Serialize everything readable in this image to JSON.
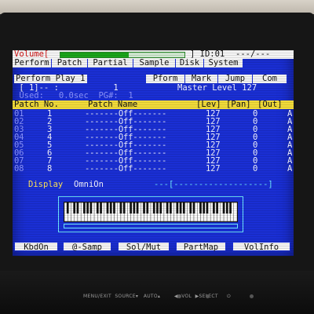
{
  "topbar": {
    "volume_label": "Volume[",
    "volume_level": 0.55,
    "id_label": "] ID:01",
    "id_value": "---/---"
  },
  "mode_tabs": [
    {
      "label": "Perform",
      "active": true
    },
    {
      "label": "Patch",
      "active": false
    },
    {
      "label": "Partial",
      "active": false
    },
    {
      "label": "Sample",
      "active": false
    },
    {
      "label": "Disk",
      "active": false
    },
    {
      "label": "System",
      "active": false
    }
  ],
  "sub": {
    "title": "Perform Play 1",
    "tabs": [
      {
        "label": "Pform",
        "active": true
      },
      {
        "label": "Mark",
        "active": false
      },
      {
        "label": "Jump",
        "active": false
      },
      {
        "label": "Com",
        "active": false
      }
    ]
  },
  "info": {
    "line1": " [ 1]-- :           1",
    "master": "Master Level 127",
    "line2": " Used:   0.0sec  PG#:  1"
  },
  "table": {
    "headers": {
      "patch_no": "Patch No.",
      "patch_name": "Patch Name",
      "level": "[Lev]",
      "pan": "[Pan]",
      "out": "[Out]"
    },
    "rows": [
      {
        "part": "01",
        "patch": "1",
        "name": "-------Off-------",
        "level": "127",
        "pan": "0",
        "out": "A"
      },
      {
        "part": "02",
        "patch": "2",
        "name": "-------Off-------",
        "level": "127",
        "pan": "0",
        "out": "A"
      },
      {
        "part": "03",
        "patch": "3",
        "name": "-------Off-------",
        "level": "127",
        "pan": "0",
        "out": "A"
      },
      {
        "part": "04",
        "patch": "4",
        "name": "-------Off-------",
        "level": "127",
        "pan": "0",
        "out": "A"
      },
      {
        "part": "05",
        "patch": "5",
        "name": "-------Off-------",
        "level": "127",
        "pan": "0",
        "out": "A"
      },
      {
        "part": "06",
        "patch": "6",
        "name": "-------Off-------",
        "level": "127",
        "pan": "0",
        "out": "A"
      },
      {
        "part": "07",
        "patch": "7",
        "name": "-------Off-------",
        "level": "127",
        "pan": "0",
        "out": "A"
      },
      {
        "part": "08",
        "patch": "8",
        "name": "-------Off-------",
        "level": "127",
        "pan": "0",
        "out": "A"
      }
    ]
  },
  "display": {
    "label": "Display",
    "value": "OmniOn",
    "range": "---[-------------------]"
  },
  "fkeys": [
    "KbdOn",
    "@-Samp",
    "Sol/Mut",
    "PartMap",
    "VolInfo"
  ],
  "bezel": {
    "text": "MENU/EXIT  SOURCE▾   AUTO▴        ◀  VOL  ▶SELECT     ⏻"
  },
  "colors": {
    "screen_bg": "#1a2fd4",
    "active_tab": "#d21414",
    "header_bg": "#f0da3a",
    "value_cyan": "#6fe9ff"
  }
}
